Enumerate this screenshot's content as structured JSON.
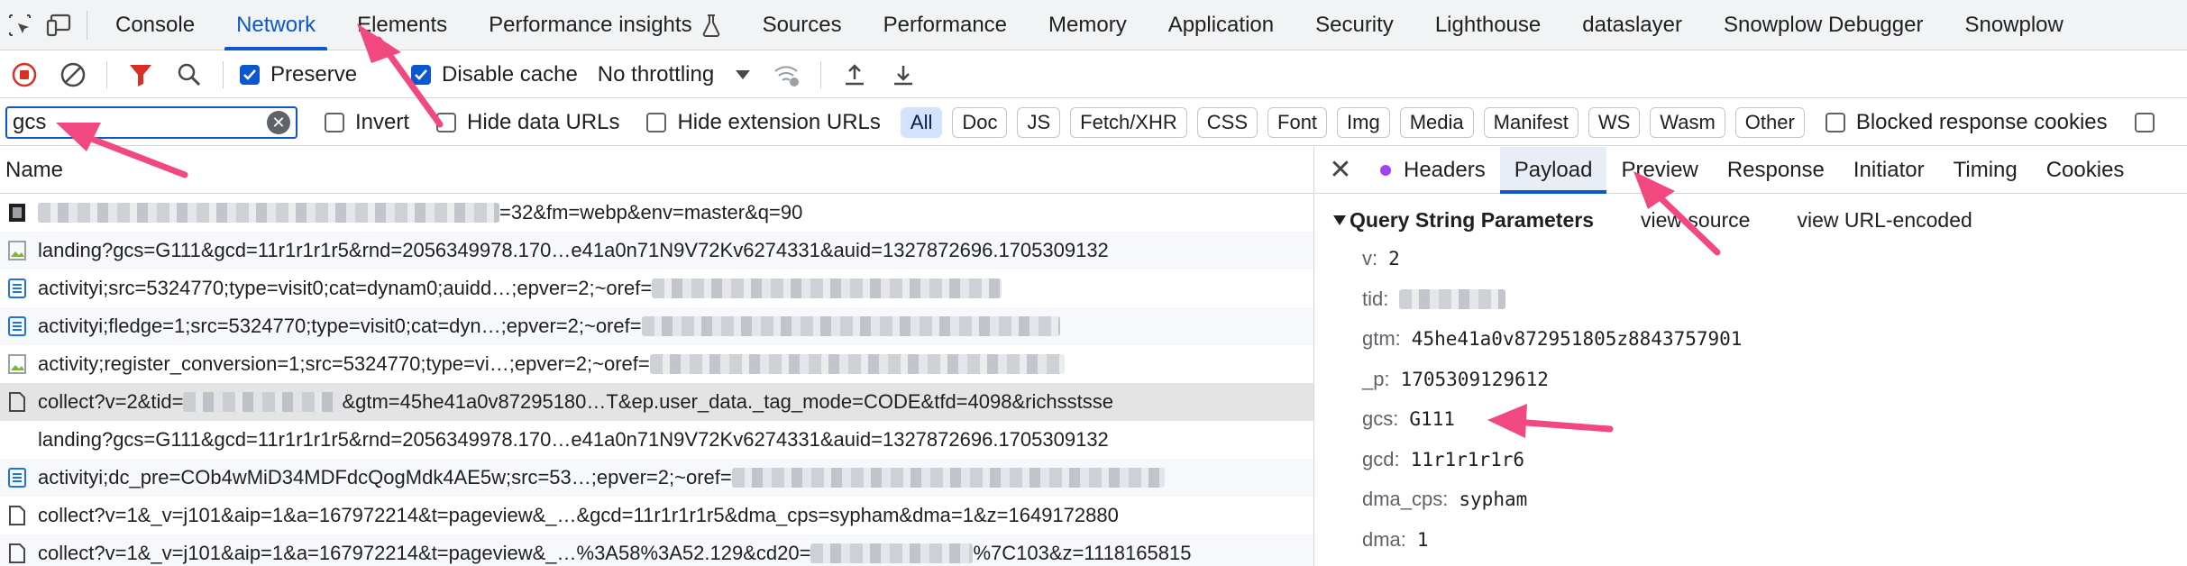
{
  "tabs": [
    "Console",
    "Network",
    "Elements",
    "Performance insights",
    "Sources",
    "Performance",
    "Memory",
    "Application",
    "Security",
    "Lighthouse",
    "dataslayer",
    "Snowplow Debugger",
    "Snowplow"
  ],
  "active_tab": "Network",
  "toolbar": {
    "preserve_label": "Preserve",
    "disable_cache_label": "Disable cache",
    "throttling_value": "No throttling"
  },
  "filter": {
    "value": "gcs",
    "invert_label": "Invert",
    "hide_data_urls_label": "Hide data URLs",
    "hide_extension_urls_label": "Hide extension URLs",
    "types": [
      "All",
      "Doc",
      "JS",
      "Fetch/XHR",
      "CSS",
      "Font",
      "Img",
      "Media",
      "Manifest",
      "WS",
      "Wasm",
      "Other"
    ],
    "active_type": "All",
    "blocked_label": "Blocked response cookies"
  },
  "requests": {
    "column_header": "Name",
    "rows": [
      {
        "icon": "image-icon",
        "pre": "",
        "post": "=32&fm=webp&env=master&q=90"
      },
      {
        "icon": "image-icon",
        "pre": "landing?gcs=G111&gcd=11r1r1r1r5&rnd=2056349978.170…e41a0n71N9V72Kv6274331&auid=1327872696.1705309132",
        "post": ""
      },
      {
        "icon": "document-icon",
        "pre": "activityi;src=5324770;type=visit0;cat=dynam0;auidd…;epver=2;~oref=",
        "post": ""
      },
      {
        "icon": "document-icon",
        "pre": "activityi;fledge=1;src=5324770;type=visit0;cat=dyn…;epver=2;~oref=",
        "post": ""
      },
      {
        "icon": "image-icon",
        "pre": "activity;register_conversion=1;src=5324770;type=vi…;epver=2;~oref=",
        "post": ""
      },
      {
        "icon": "file-icon",
        "pre": "collect?v=2&tid=",
        "post": "&gtm=45he41a0v87295180…T&ep.user_data._tag_mode=CODE&tfd=4098&richsstsse"
      },
      {
        "icon": "none",
        "pre": "landing?gcs=G111&gcd=11r1r1r1r5&rnd=2056349978.170…e41a0n71N9V72Kv6274331&auid=1327872696.1705309132",
        "post": ""
      },
      {
        "icon": "document-icon",
        "pre": "activityi;dc_pre=COb4wMiD34MDFdcQogMdk4AE5w;src=53…;epver=2;~oref=",
        "post": ""
      },
      {
        "icon": "file-icon",
        "pre": "collect?v=1&_v=j101&aip=1&a=167972214&t=pageview&_…&gcd=11r1r1r1r5&dma_cps=sypham&dma=1&z=1649172880",
        "post": ""
      },
      {
        "icon": "file-icon",
        "pre": "collect?v=1&_v=j101&aip=1&a=167972214&t=pageview&_…%3A58%3A52.129&cd20=",
        "post": "%7C103&z=1118165815"
      }
    ]
  },
  "details": {
    "tabs": [
      "Headers",
      "Payload",
      "Preview",
      "Response",
      "Initiator",
      "Timing",
      "Cookies"
    ],
    "active_tab": "Payload",
    "section_title": "Query String Parameters",
    "view_source": "view source",
    "view_url_encoded": "view URL-encoded",
    "params": [
      {
        "key": "v:",
        "value": "2"
      },
      {
        "key": "tid:",
        "value": ""
      },
      {
        "key": "gtm:",
        "value": "45he41a0v872951805z8843757901"
      },
      {
        "key": "_p:",
        "value": "1705309129612"
      },
      {
        "key": "gcs:",
        "value": "G111"
      },
      {
        "key": "gcd:",
        "value": "11r1r1r1r6"
      },
      {
        "key": "dma_cps:",
        "value": "sypham"
      },
      {
        "key": "dma:",
        "value": "1"
      }
    ]
  },
  "colors": {
    "accent": "#0b57d0",
    "annotation": "#f0487f",
    "record_red": "#d93025",
    "filter_red": "#d93025"
  }
}
